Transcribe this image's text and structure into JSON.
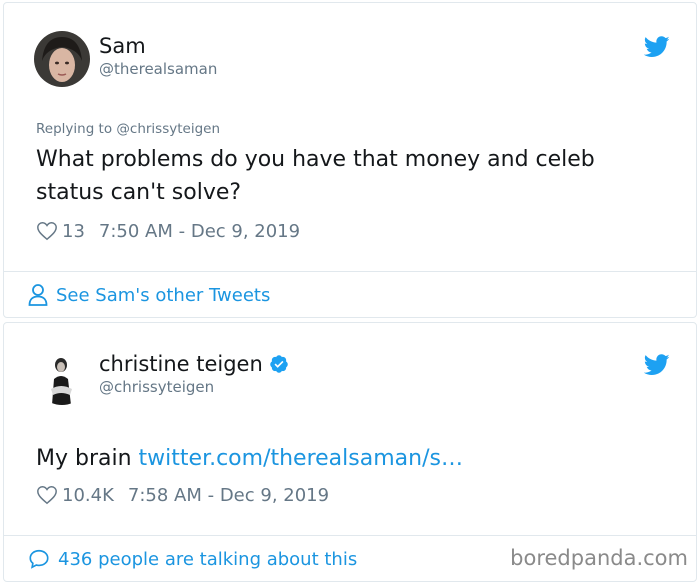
{
  "tweet1": {
    "name": "Sam",
    "handle": "@therealsaman",
    "replying": "Replying to @chrissyteigen",
    "text": "What problems do you have that money and celeb status can't solve?",
    "likes": "13",
    "timestamp": "7:50 AM - Dec 9, 2019",
    "footer": "See Sam's other Tweets",
    "icons": [
      "avatar",
      "twitter-bird-icon",
      "heart-icon",
      "person-icon"
    ]
  },
  "tweet2": {
    "name": "christine teigen",
    "handle": "@chrissyteigen",
    "text_prefix": "My brain ",
    "link": "twitter.com/therealsaman/s…",
    "likes": "10.4K",
    "timestamp": "7:58 AM - Dec 9, 2019",
    "footer": "436 people are talking about this",
    "icons": [
      "avatar",
      "verified-badge-icon",
      "twitter-bird-icon",
      "heart-icon",
      "speech-bubble-icon"
    ]
  },
  "watermark": "boredpanda.com",
  "colors": {
    "link": "#1b95e0",
    "muted": "#657786",
    "border": "#e1e8ed",
    "text": "#14171a"
  }
}
